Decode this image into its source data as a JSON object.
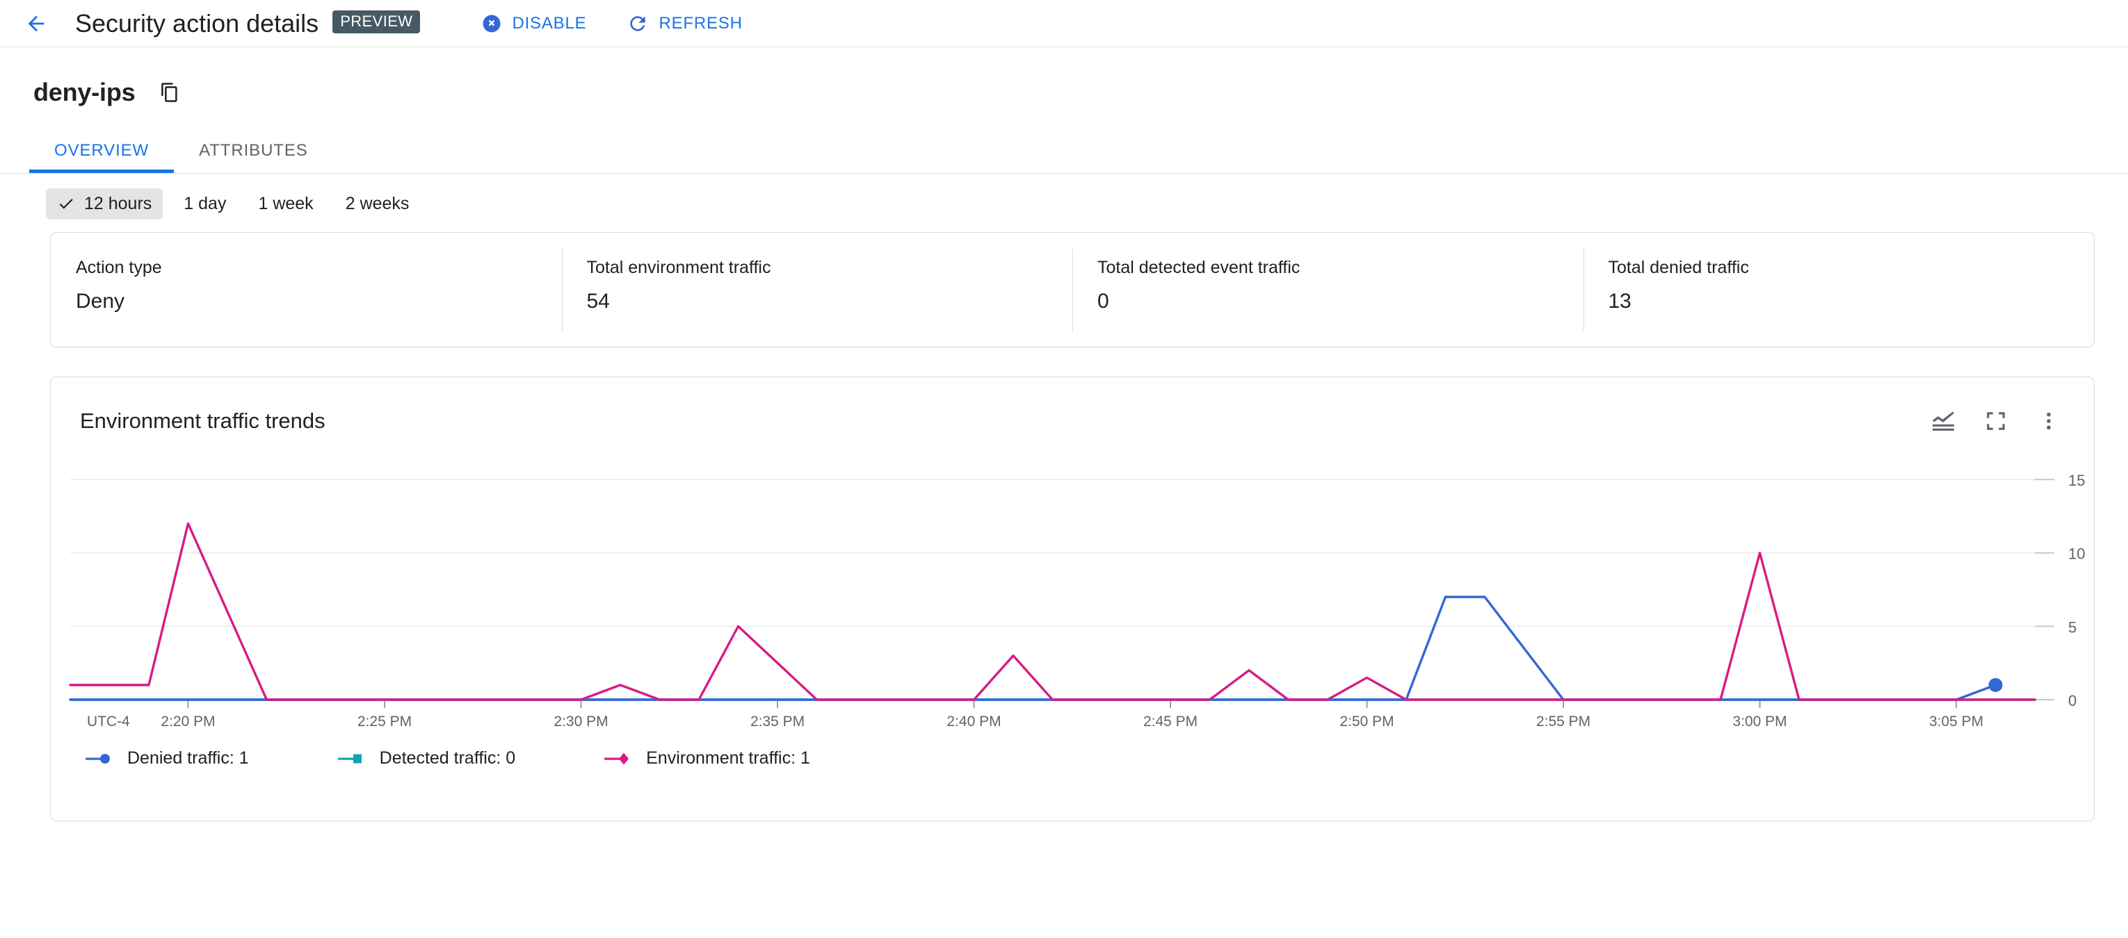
{
  "topbar": {
    "back_icon": "arrow-back-icon",
    "title": "Security action details",
    "preview_badge": "PREVIEW",
    "actions": [
      {
        "id": "disable",
        "label": "DISABLE",
        "icon": "cancel-circle-icon"
      },
      {
        "id": "refresh",
        "label": "REFRESH",
        "icon": "refresh-icon"
      }
    ]
  },
  "resource": {
    "name": "deny-ips",
    "copy_icon": "copy-icon"
  },
  "tabs": [
    {
      "id": "overview",
      "label": "OVERVIEW",
      "active": true
    },
    {
      "id": "attributes",
      "label": "ATTRIBUTES",
      "active": false
    }
  ],
  "time_range": {
    "check_icon": "check-icon",
    "options": [
      {
        "id": "12h",
        "label": "12 hours",
        "selected": true
      },
      {
        "id": "1d",
        "label": "1 day",
        "selected": false
      },
      {
        "id": "1w",
        "label": "1 week",
        "selected": false
      },
      {
        "id": "2w",
        "label": "2 weeks",
        "selected": false
      }
    ]
  },
  "summary": {
    "stats": [
      {
        "label": "Action type",
        "value": "Deny"
      },
      {
        "label": "Total environment traffic",
        "value": "54"
      },
      {
        "label": "Total detected event traffic",
        "value": "0"
      },
      {
        "label": "Total denied traffic",
        "value": "13"
      }
    ]
  },
  "chart_card": {
    "title": "Environment traffic trends",
    "tools": [
      {
        "id": "chart-type",
        "icon": "stacked-line-chart-icon"
      },
      {
        "id": "fullscreen",
        "icon": "fullscreen-expand-icon"
      },
      {
        "id": "more",
        "icon": "more-vert-icon"
      }
    ]
  },
  "colors": {
    "accent_blue": "#1a73e8",
    "series_denied": "#3367d6",
    "series_detected": "#12a4b4",
    "series_environment": "#d81b84",
    "badge_bg": "#455a64",
    "grid": "#eeeeee",
    "axis": "#80868b"
  },
  "chart_data": {
    "type": "line",
    "title": "Environment traffic trends",
    "xlabel": "",
    "ylabel": "",
    "timezone_label": "UTC-4",
    "grid": true,
    "legend_position": "bottom",
    "ylim": [
      0,
      16
    ],
    "yticks": [
      0,
      5,
      10,
      15
    ],
    "ytick_labels": [
      "0",
      "5",
      "10",
      "15"
    ],
    "xticks": [
      "2:20 PM",
      "2:25 PM",
      "2:30 PM",
      "2:35 PM",
      "2:40 PM",
      "2:45 PM",
      "2:50 PM",
      "2:55 PM",
      "3:00 PM",
      "3:05 PM"
    ],
    "x_start": "2:17 PM",
    "x_end": "3:07 PM",
    "x_minutes_start": 137,
    "x_minutes_end": 187,
    "series": [
      {
        "name": "Denied traffic",
        "legend_label": "Denied traffic: 1",
        "color": "#3367d6",
        "marker": "circle",
        "current_value": 1,
        "points": [
          [
            137,
            0
          ],
          [
            153,
            0
          ],
          [
            154,
            0
          ],
          [
            163,
            0
          ],
          [
            164,
            0
          ],
          [
            166,
            0
          ],
          [
            170,
            0
          ],
          [
            171,
            0
          ],
          [
            172,
            7
          ],
          [
            173,
            7
          ],
          [
            175,
            0
          ],
          [
            176,
            0
          ],
          [
            183,
            0
          ],
          [
            185,
            0
          ],
          [
            186,
            1
          ]
        ]
      },
      {
        "name": "Detected traffic",
        "legend_label": "Detected traffic: 0",
        "color": "#12a4b4",
        "marker": "square",
        "current_value": 0,
        "points": [
          [
            137,
            0
          ],
          [
            187,
            0
          ]
        ]
      },
      {
        "name": "Environment traffic",
        "legend_label": "Environment traffic: 1",
        "color": "#d81b84",
        "marker": "diamond",
        "current_value": 1,
        "points": [
          [
            137,
            1
          ],
          [
            139,
            1
          ],
          [
            140,
            12
          ],
          [
            142,
            0
          ],
          [
            150,
            0
          ],
          [
            151,
            1
          ],
          [
            152,
            0
          ],
          [
            153,
            0
          ],
          [
            154,
            5
          ],
          [
            156,
            0
          ],
          [
            160,
            0
          ],
          [
            161,
            3
          ],
          [
            162,
            0
          ],
          [
            166,
            0
          ],
          [
            167,
            2
          ],
          [
            168,
            0
          ],
          [
            169,
            0
          ],
          [
            170,
            1.5
          ],
          [
            171,
            0
          ],
          [
            179,
            0
          ],
          [
            180,
            10
          ],
          [
            181,
            0
          ],
          [
            186,
            0
          ],
          [
            187,
            0
          ]
        ]
      }
    ]
  }
}
